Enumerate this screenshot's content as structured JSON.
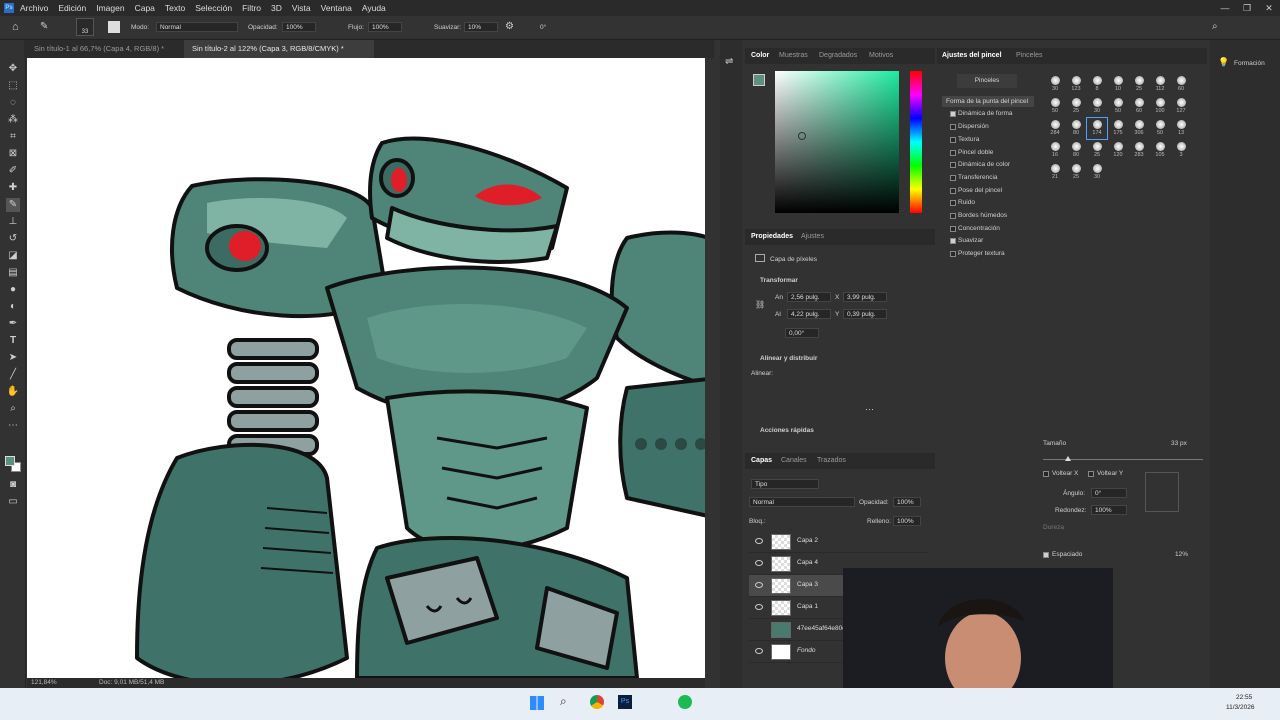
{
  "menu": [
    "Archivo",
    "Edición",
    "Imagen",
    "Capa",
    "Texto",
    "Selección",
    "Filtro",
    "3D",
    "Vista",
    "Ventana",
    "Ayuda"
  ],
  "options": {
    "brush_size": "33",
    "mode_label": "Modo:",
    "mode_value": "Normal",
    "opacity_label": "Opacidad:",
    "opacity_value": "100%",
    "flow_label": "Flujo:",
    "flow_value": "100%",
    "smooth_label": "Suavizar:",
    "smooth_value": "10%",
    "angle_value": "0°"
  },
  "doc_tabs": [
    {
      "label": "Sin título-1 al 66,7% (Capa 4, RGB/8) *"
    },
    {
      "label": "Sin título-2 al 122% (Capa 3, RGB/8/CMYK) *"
    }
  ],
  "status": {
    "zoom": "121,84%",
    "doc": "Doc: 9,01 MB/51,4 MB"
  },
  "color_panel": {
    "tabs": [
      "Color",
      "Muestras",
      "Degradados",
      "Motivos"
    ],
    "accent": "#5e8f80"
  },
  "properties": {
    "tabs": [
      "Propiedades",
      "Ajustes"
    ],
    "layer_type": "Capa de píxeles",
    "transform_title": "Transformar",
    "w_label": "An",
    "w_value": "2,56 pulg.",
    "x_label": "X",
    "x_value": "3,99 pulg.",
    "h_label": "Al",
    "h_value": "4,22 pulg.",
    "y_label": "Y",
    "y_value": "0,39 pulg.",
    "rot_value": "0,00°",
    "align_title": "Alinear y distribuir",
    "align_label": "Alinear:",
    "quick_title": "Acciones rápidas"
  },
  "layers": {
    "tabs": [
      "Capas",
      "Canales",
      "Trazados"
    ],
    "filter": "Tipo",
    "blend": "Normal",
    "opacity_label": "Opacidad:",
    "opacity_value": "100%",
    "lock_label": "Bloq.:",
    "fill_label": "Relleno:",
    "fill_value": "100%",
    "items": [
      {
        "name": "Capa 2",
        "visible": true
      },
      {
        "name": "Capa 4",
        "visible": true
      },
      {
        "name": "Capa 3",
        "visible": true,
        "selected": true
      },
      {
        "name": "Capa 1",
        "visible": true
      },
      {
        "name": "47ee45af64e80ee",
        "visible": false
      },
      {
        "name": "Fondo",
        "visible": true
      }
    ]
  },
  "brush_settings": {
    "tabs": [
      "Ajustes del pincel",
      "Pinceles"
    ],
    "pinceles_button": "Pinceles",
    "tip_shape": "Forma de la punta del pincel",
    "options": [
      {
        "label": "Dinámica de forma",
        "checked": true
      },
      {
        "label": "Dispersión",
        "checked": false
      },
      {
        "label": "Textura",
        "checked": false
      },
      {
        "label": "Pincel doble",
        "checked": false
      },
      {
        "label": "Dinámica de color",
        "checked": false
      },
      {
        "label": "Transferencia",
        "checked": false
      },
      {
        "label": "Pose del pincel",
        "checked": false
      },
      {
        "label": "Ruido",
        "checked": false
      },
      {
        "label": "Bordes húmedos",
        "checked": false
      },
      {
        "label": "Concentración",
        "checked": false
      },
      {
        "label": "Suavizar",
        "checked": true
      },
      {
        "label": "Proteger textura",
        "checked": false
      }
    ],
    "preset_sizes": [
      "30",
      "123",
      "8",
      "10",
      "25",
      "112",
      "60",
      "50",
      "25",
      "30",
      "50",
      "60",
      "100",
      "127",
      "284",
      "80",
      "174",
      "175",
      "306",
      "50",
      "13",
      "16",
      "80",
      "25",
      "120",
      "283",
      "105",
      "3",
      "21",
      "25",
      "30"
    ],
    "size_label": "Tamaño",
    "size_value": "33 px",
    "flip_x": "Voltear X",
    "flip_y": "Voltear Y",
    "angle_label": "Ángulo:",
    "angle_value": "0°",
    "round_label": "Redondez:",
    "round_value": "100%",
    "hardness_label": "Dureza",
    "spacing_label": "Espaciado",
    "spacing_value": "12%"
  },
  "right_panel": {
    "learn": "Formación"
  },
  "taskbar": {
    "time": "22:55",
    "date": "11/3/2026"
  }
}
